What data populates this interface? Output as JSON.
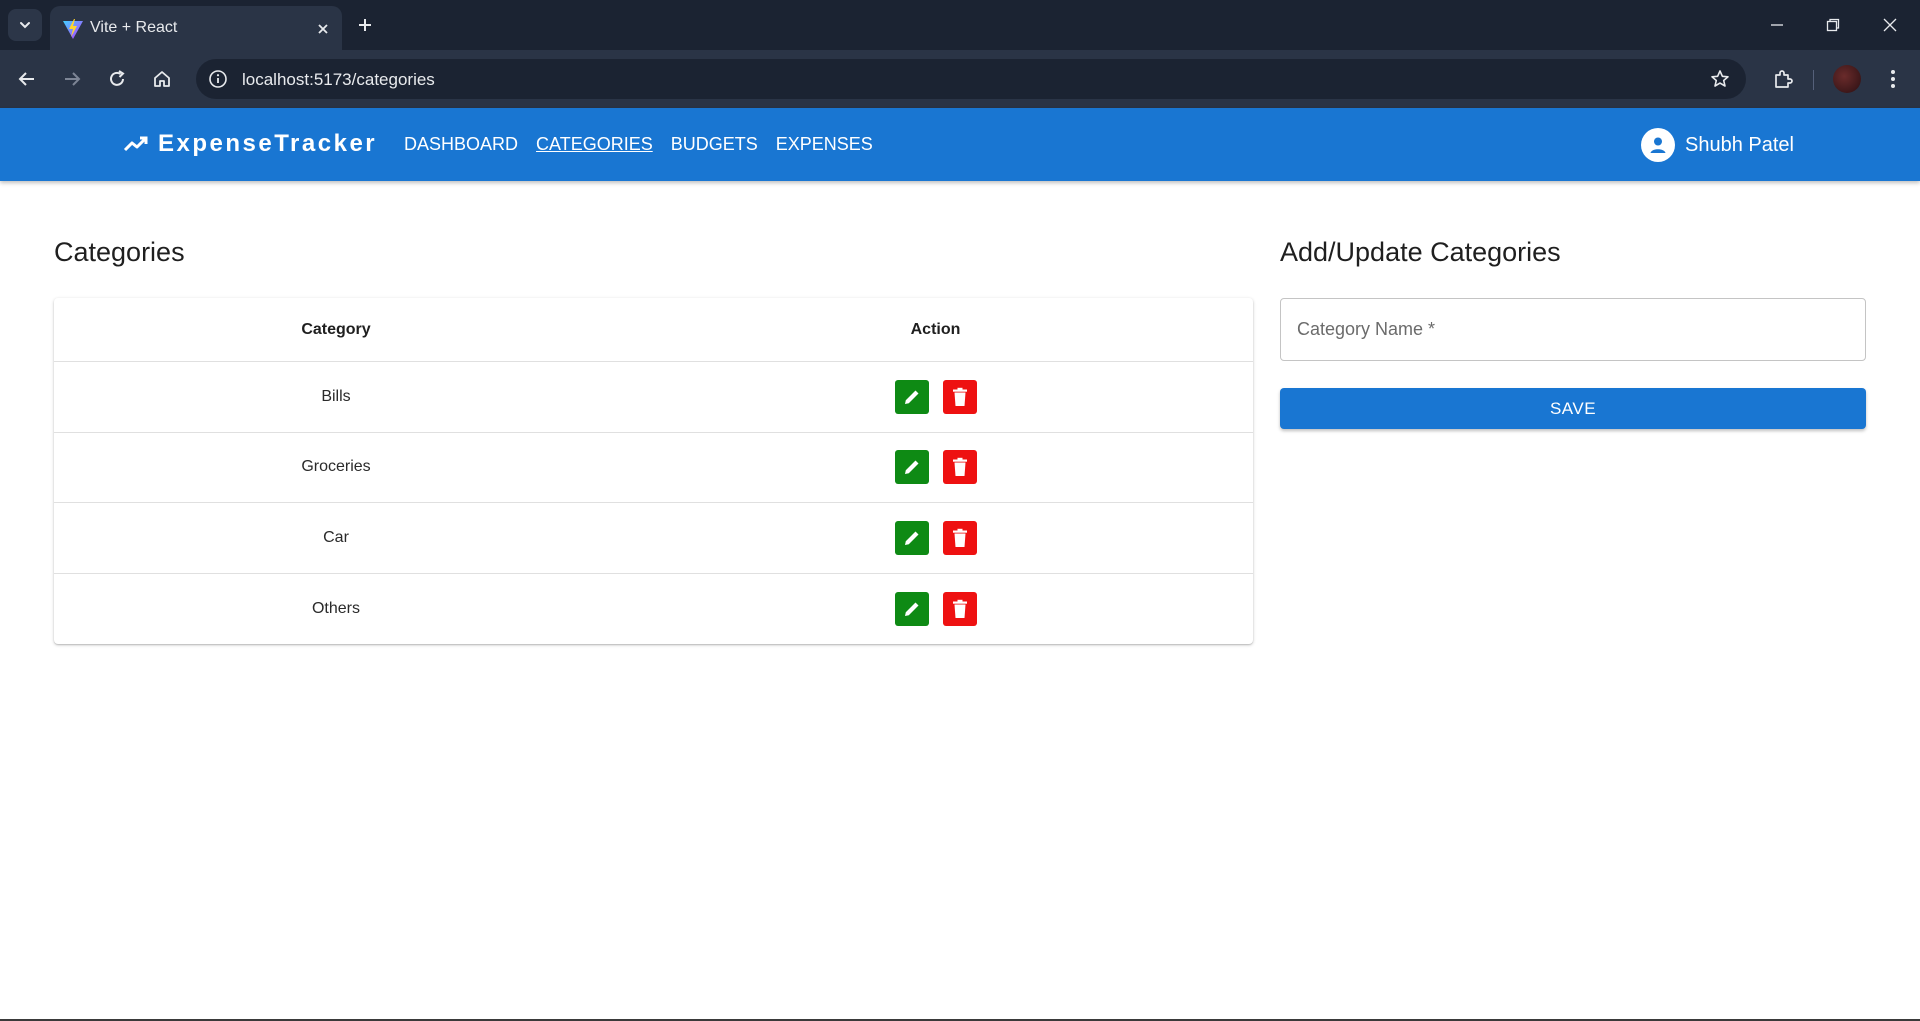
{
  "browser": {
    "tab_title": "Vite + React",
    "url": "localhost:5173/categories"
  },
  "app": {
    "brand": "ExpenseTracker",
    "nav": [
      {
        "label": "DASHBOARD",
        "active": false
      },
      {
        "label": "CATEGORIES",
        "active": true
      },
      {
        "label": "BUDGETS",
        "active": false
      },
      {
        "label": "EXPENSES",
        "active": false
      }
    ],
    "user_name": "Shubh Patel",
    "accent_color": "#1976d2"
  },
  "categories": {
    "title": "Categories",
    "columns": [
      "Category",
      "Action"
    ],
    "rows": [
      "Bills",
      "Groceries",
      "Car",
      "Others"
    ],
    "edit_color": "#0e8a14",
    "delete_color": "#ee1111"
  },
  "form": {
    "title": "Add/Update Categories",
    "placeholder": "Category Name *",
    "value": "",
    "save_label": "SAVE"
  }
}
